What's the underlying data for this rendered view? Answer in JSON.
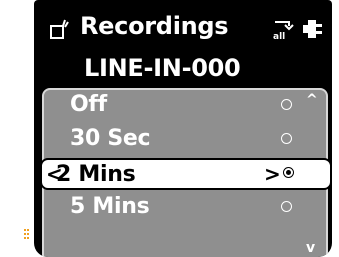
{
  "header": {
    "title": "Recordings",
    "left_icon": "recordings-icon",
    "right_icons": [
      "usb-icon",
      "power-plug-icon"
    ]
  },
  "subtitle": "LINE-IN-000",
  "list": {
    "items": [
      {
        "label": "Off",
        "selected": false
      },
      {
        "label": "30 Sec",
        "selected": false
      },
      {
        "label": "2 Mins",
        "selected": true
      },
      {
        "label": "5 Mins",
        "selected": false
      }
    ],
    "left_arrow": "<",
    "right_arrow": ">"
  },
  "scroll": {
    "up": "^",
    "down": "v"
  },
  "colors": {
    "background": "#000000",
    "panel": "#8f8f8f",
    "panel_border": "#d8d8d8",
    "text": "#ffffff",
    "selected_bg": "#ffffff",
    "accent": "#f0a020"
  }
}
